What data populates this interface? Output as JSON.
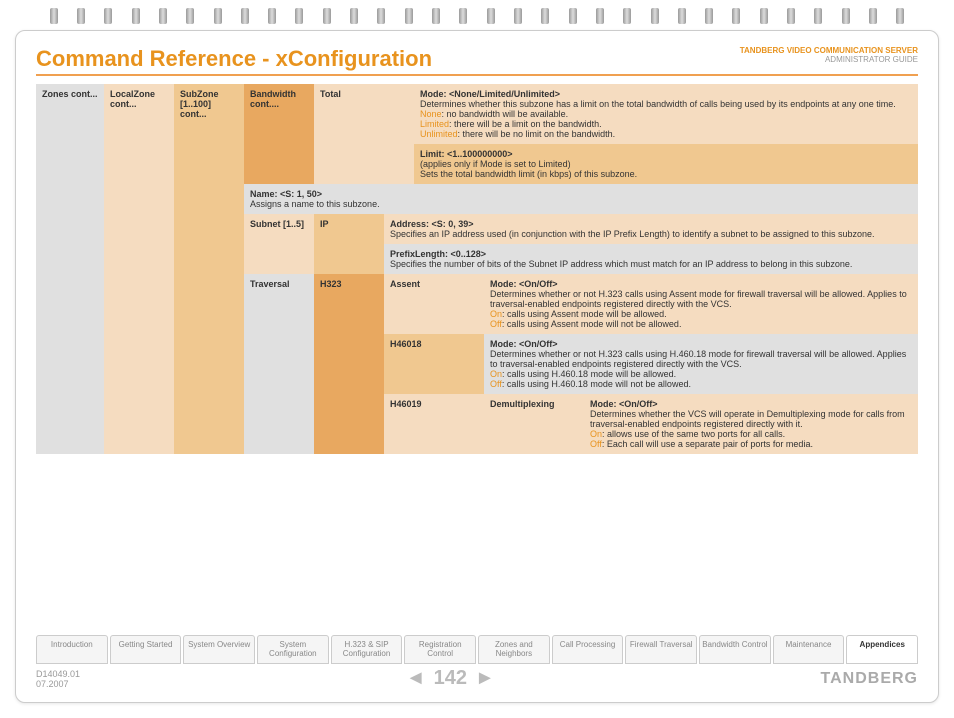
{
  "header": {
    "title": "Command Reference - xConfiguration",
    "product": "TANDBERG",
    "product2": "VIDEO COMMUNICATION SERVER",
    "subtitle": "ADMINISTRATOR GUIDE"
  },
  "cols": {
    "c1": "Zones cont...",
    "c2": "LocalZone cont...",
    "c3": "SubZone [1..100] cont...",
    "c4": "Bandwidth cont...."
  },
  "bw_total": {
    "label": "Total",
    "r1": {
      "title": "Mode: <None/Limited/Unlimited>",
      "desc": "Determines whether this subzone has a limit on the total bandwidth of calls being used by its endpoints at any one time.",
      "none": "None",
      "none_t": ": no bandwidth will be available.",
      "lim": "Limited",
      "lim_t": ": there will be a limit on the bandwidth.",
      "unl": "Unlimited",
      "unl_t": ": there will be no limit on the bandwidth."
    },
    "r2": {
      "title": "Limit: <1..100000000>",
      "l1": "(applies only if Mode is set to Limited)",
      "l2": "Sets the total bandwidth limit (in kbps) of this subzone."
    }
  },
  "name": {
    "title": "Name: <S: 1, 50>",
    "desc": "Assigns a name to this subzone."
  },
  "subnet": {
    "label": "Subnet [1..5]",
    "ip": "IP",
    "r1": {
      "title": "Address: <S: 0, 39>",
      "desc": "Specifies an IP address used (in conjunction with the IP Prefix Length) to identify a subnet to be assigned to this subzone."
    },
    "r2": {
      "title": "PrefixLength: <0..128>",
      "desc": "Specifies the number of bits of the Subnet IP address which must match for an IP address to belong in this subzone."
    }
  },
  "trav": {
    "label": "Traversal",
    "h323": "H323",
    "assent": {
      "label": "Assent",
      "title": "Mode: <On/Off>",
      "desc": "Determines whether or not H.323 calls using Assent mode for firewall traversal will be allowed. Applies to traversal-enabled endpoints registered directly with the VCS.",
      "on": "On",
      "on_t": ": calls using Assent mode will be allowed.",
      "off": "Off",
      "off_t": ": calls using Assent mode will not be allowed."
    },
    "h46018": {
      "label": "H46018",
      "title": "Mode: <On/Off>",
      "desc": "Determines whether or not H.323 calls using H.460.18 mode for firewall traversal will be allowed. Applies to traversal-enabled endpoints registered directly with the VCS.",
      "on": "On",
      "on_t": ": calls using H.460.18 mode will be allowed.",
      "off": "Off",
      "off_t": ": calls using H.460.18 mode will not be allowed."
    },
    "h46019": {
      "label": "H46019",
      "demux": "Demultiplexing",
      "title": "Mode: <On/Off>",
      "desc": "Determines whether the VCS will operate in Demultiplexing mode for calls from traversal-enabled endpoints registered directly with it.",
      "on": "On",
      "on_t": ": allows use of the same two ports for all calls.",
      "off": "Off",
      "off_t": ": Each call will use a separate pair of ports for media."
    }
  },
  "tabs": [
    "Introduction",
    "Getting Started",
    "System Overview",
    "System Configuration",
    "H.323 & SIP Configuration",
    "Registration Control",
    "Zones and Neighbors",
    "Call Processing",
    "Firewall Traversal",
    "Bandwidth Control",
    "Maintenance",
    "Appendices"
  ],
  "footer": {
    "doc": "D14049.01",
    "date": "07.2007",
    "page": "142",
    "brand": "TANDBERG"
  }
}
